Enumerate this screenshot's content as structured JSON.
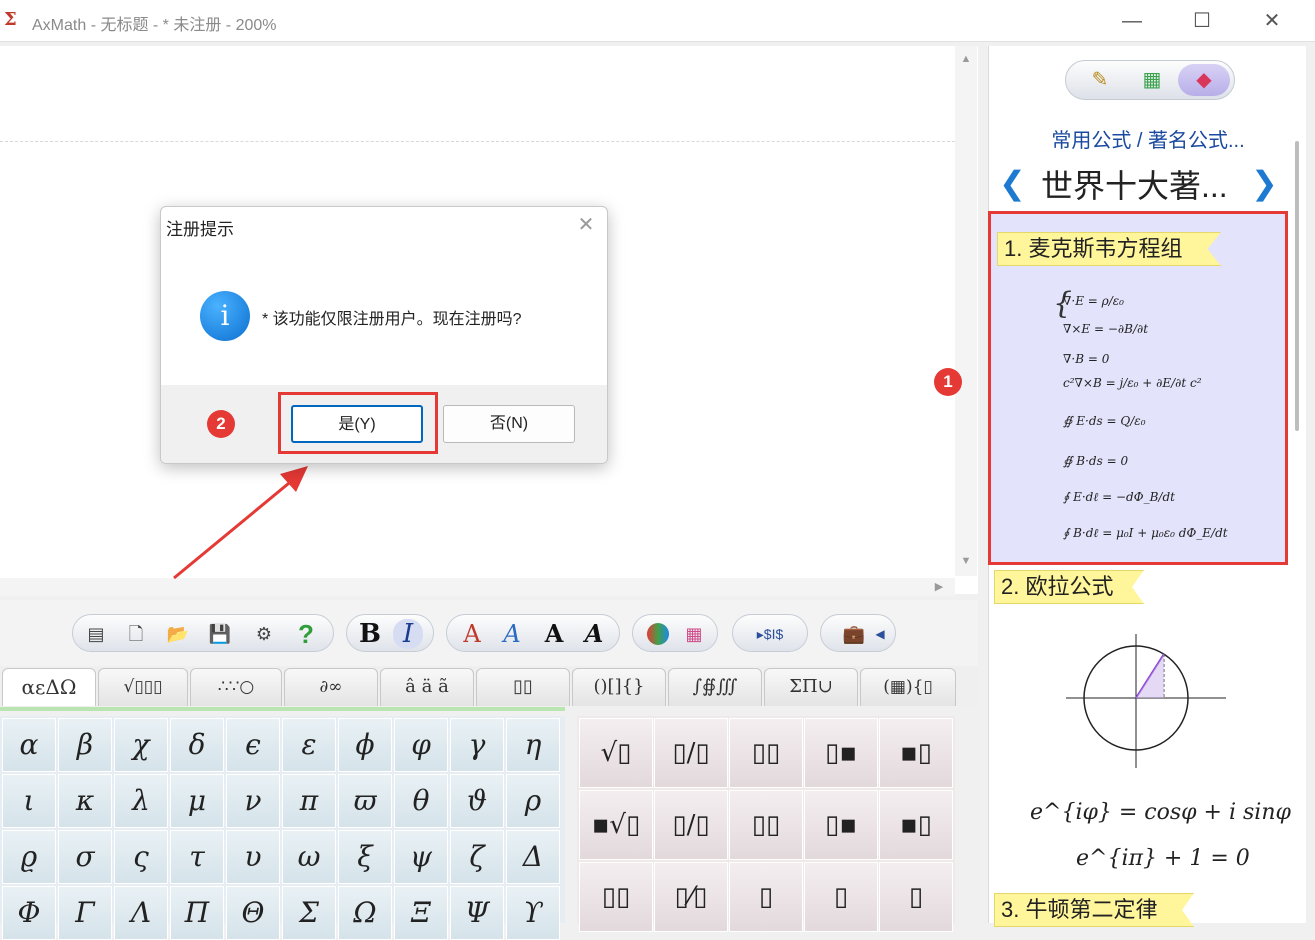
{
  "window": {
    "title": "AxMath - 无标题 - * 未注册 - 200%",
    "minimize": "—",
    "maximize": "☐",
    "close": "✕"
  },
  "toolbar": {
    "bold": "B",
    "italic": "I",
    "help": "?",
    "font_a1": "A",
    "font_a2": "A",
    "font_a3": "A",
    "font_a4": "A",
    "text_insert": "$I$"
  },
  "tabs": [
    {
      "label": "αεΔΩ"
    },
    {
      "label": "√▯▯▯"
    },
    {
      "label": "∴∵○"
    },
    {
      "label": "∂∞"
    },
    {
      "label": "â ä ã"
    },
    {
      "label": "▯▯"
    },
    {
      "label": "()[]{}"
    },
    {
      "label": "∫∯∭"
    },
    {
      "label": "ΣΠ∪"
    },
    {
      "label": "(▦){▯"
    }
  ],
  "greek": [
    [
      "α",
      "β",
      "χ",
      "δ",
      "ϵ",
      "ε",
      "ϕ",
      "φ",
      "γ",
      "η"
    ],
    [
      "ι",
      "κ",
      "λ",
      "μ",
      "ν",
      "π",
      "ϖ",
      "θ",
      "ϑ",
      "ρ"
    ],
    [
      "ϱ",
      "σ",
      "ς",
      "τ",
      "υ",
      "ω",
      "ξ",
      "ψ",
      "ζ",
      "Δ"
    ],
    [
      "Φ",
      "Γ",
      "Λ",
      "Π",
      "Θ",
      "Σ",
      "Ω",
      "Ξ",
      "Ψ",
      "ϒ"
    ]
  ],
  "templates": [
    [
      "√▯",
      "▯/▯",
      "▯▯",
      "▯▪",
      "▪▯"
    ],
    [
      "▪√▯",
      "▯/▯",
      "▯▯",
      "▯▪",
      "▪▯"
    ],
    [
      "▯▯",
      "▯⁄▯",
      "▯",
      "▯",
      "▯"
    ]
  ],
  "right_panel": {
    "category": "常用公式 / 著名公式...",
    "heading": "世界十大著...",
    "nav_prev": "❮",
    "nav_next": "❯",
    "formulas": [
      {
        "tag": "1. 麦克斯韦方程组"
      },
      {
        "tag": "2. 欧拉公式"
      },
      {
        "tag": "3. 牛顿第二定律"
      }
    ],
    "maxwell_lines": [
      "∇·E = ρ/ε₀",
      "∇×E = −∂B/∂t",
      "∇·B = 0",
      "c²∇×B = j/ε₀ + ∂E/∂t c²",
      "∯ E·ds = Q/ε₀",
      "∯ B·ds = 0",
      "∮ E·dℓ = −dΦ_B/dt",
      "∮ B·dℓ = μ₀I + μ₀ε₀ dΦ_E/dt"
    ],
    "euler_line1": "e^{iφ} = cosφ + i sinφ",
    "euler_line2": "e^{iπ} + 1 = 0"
  },
  "dialog": {
    "title": "注册提示",
    "close": "✕",
    "icon": "i",
    "message": "* 该功能仅限注册用户。现在注册吗?",
    "yes_label": "是(Y)",
    "no_label": "否(N)"
  },
  "annotations": {
    "badge1": "1",
    "badge2": "2"
  },
  "colors": {
    "highlight": "#e53935",
    "accent_blue": "#1e7ad0",
    "tag_yellow": "#fff59a"
  }
}
